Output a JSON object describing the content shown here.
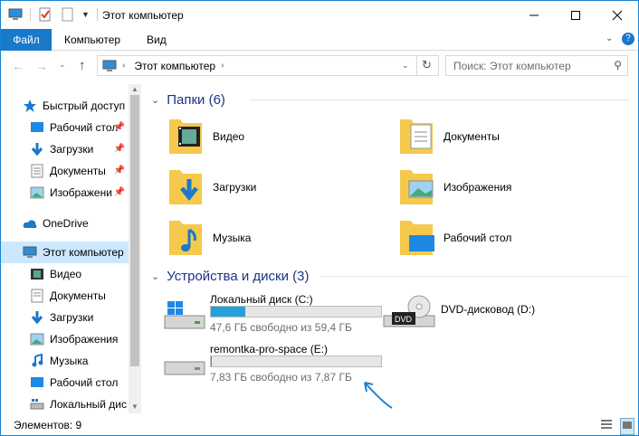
{
  "window": {
    "title": "Этот компьютер"
  },
  "ribbon": {
    "file": "Файл",
    "tabs": [
      "Компьютер",
      "Вид"
    ]
  },
  "address": {
    "path": "Этот компьютер",
    "search_placeholder": "Поиск: Этот компьютер"
  },
  "sidebar": {
    "items": [
      {
        "label": "Быстрый доступ",
        "icon": "star-icon"
      },
      {
        "label": "Рабочий стол",
        "icon": "desktop-icon",
        "pinned": true
      },
      {
        "label": "Загрузки",
        "icon": "download-icon",
        "pinned": true
      },
      {
        "label": "Документы",
        "icon": "document-icon",
        "pinned": true
      },
      {
        "label": "Изображени",
        "icon": "picture-icon",
        "pinned": true
      },
      {
        "label": "OneDrive",
        "icon": "cloud-icon"
      },
      {
        "label": "Этот компьютер",
        "icon": "computer-icon",
        "selected": true
      },
      {
        "label": "Видео",
        "icon": "video-icon"
      },
      {
        "label": "Документы",
        "icon": "document-icon"
      },
      {
        "label": "Загрузки",
        "icon": "download-icon"
      },
      {
        "label": "Изображения",
        "icon": "picture-icon"
      },
      {
        "label": "Музыка",
        "icon": "music-icon"
      },
      {
        "label": "Рабочий стол",
        "icon": "desktop-icon"
      },
      {
        "label": "Локальный дис",
        "icon": "drive-icon"
      }
    ]
  },
  "folders": {
    "header": "Папки (6)",
    "items": [
      "Видео",
      "Документы",
      "Загрузки",
      "Изображения",
      "Музыка",
      "Рабочий стол"
    ]
  },
  "devices": {
    "header": "Устройства и диски (3)",
    "items": [
      {
        "name": "Локальный диск (C:)",
        "free": "47,6 ГБ свободно из 59,4 ГБ",
        "used_fraction": 0.2
      },
      {
        "name": "DVD-дисковод (D:)"
      },
      {
        "name": "remontka-pro-space (E:)",
        "free": "7,83 ГБ свободно из 7,87 ГБ",
        "used_fraction": 0.005
      }
    ]
  },
  "status": {
    "count": "Элементов: 9"
  },
  "colors": {
    "accent": "#1979ca",
    "bar_fill": "#26a0da",
    "group_header": "#1e3287",
    "annotation_arrow": "#1e7fd0"
  }
}
